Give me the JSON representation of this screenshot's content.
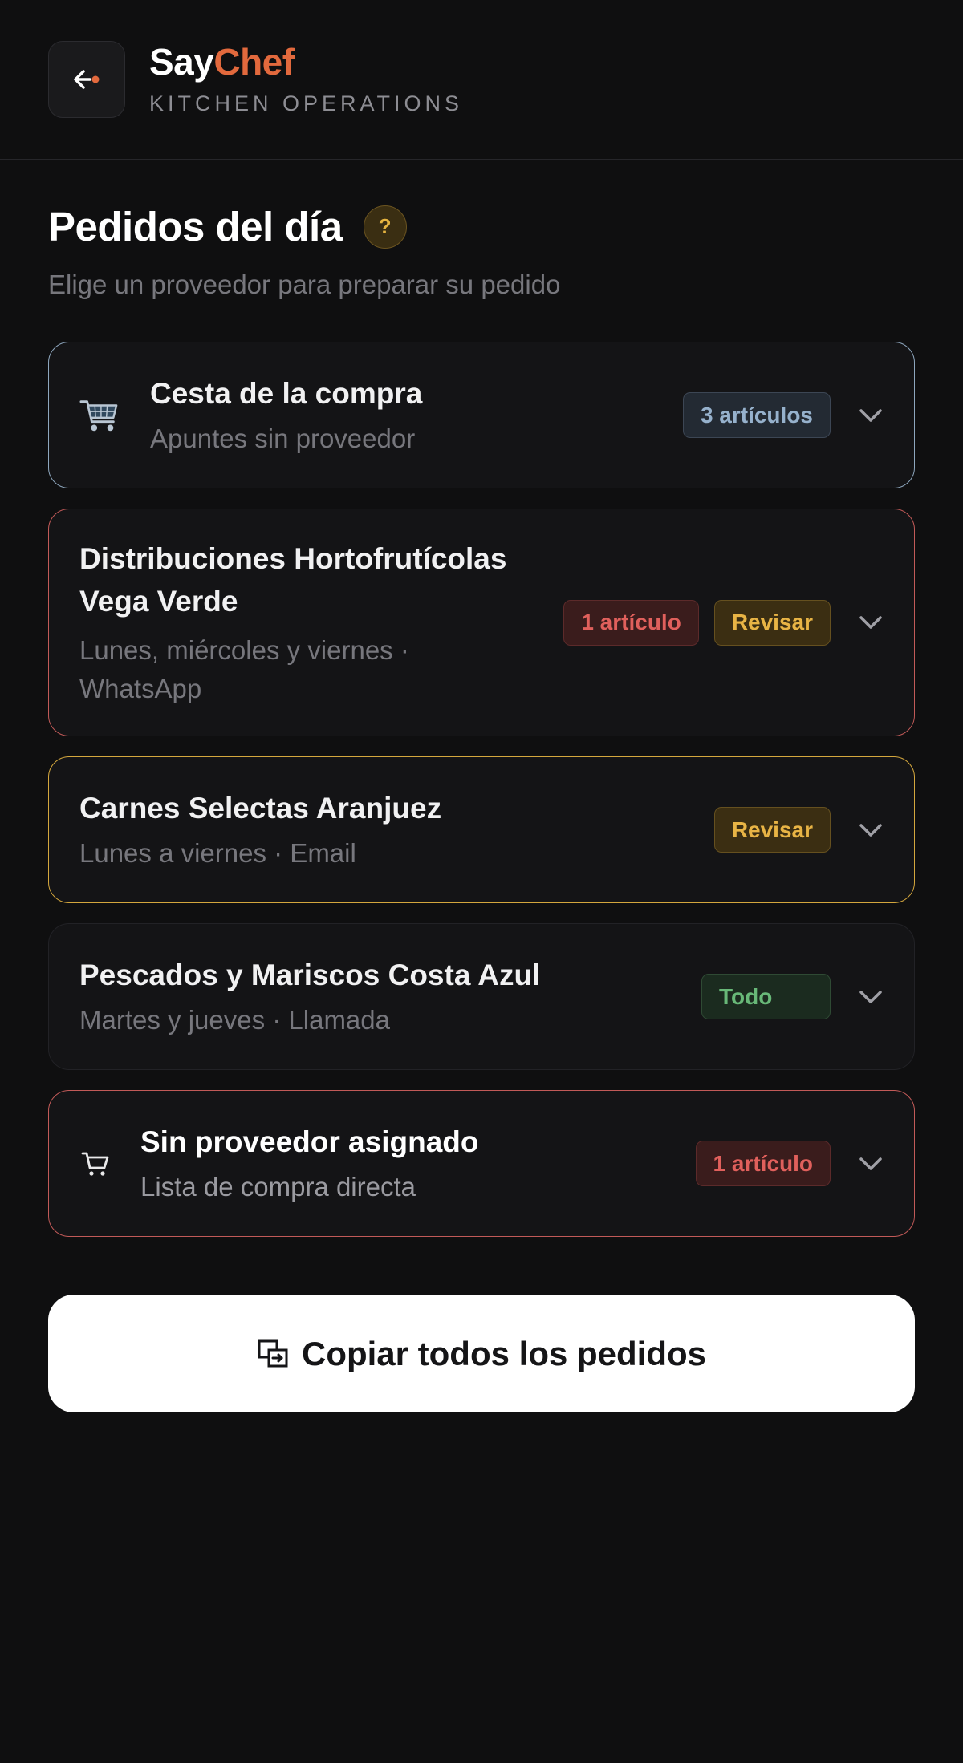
{
  "header": {
    "brand_say": "Say",
    "brand_chef": "Chef",
    "brand_subtitle": "KITCHEN OPERATIONS"
  },
  "page": {
    "title": "Pedidos del día",
    "help_label": "?",
    "subtitle": "Elige un proveedor para preparar su pedido"
  },
  "cards": [
    {
      "title": "Cesta de la compra",
      "subtitle": "Apuntes sin proveedor",
      "badges": [
        "3 artículos"
      ],
      "icon": "shopping-cart-emoji-icon",
      "border_color": "#8ea7be"
    },
    {
      "title": "Distribuciones Hortofrutícolas Vega Verde",
      "subtitle": "Lunes, miércoles y viernes · WhatsApp",
      "badges": [
        "1 artículo",
        "Revisar"
      ],
      "border_color": "#c25a58"
    },
    {
      "title": "Carnes Selectas Aranjuez",
      "subtitle": "Lunes a viernes · Email",
      "badges": [
        "Revisar"
      ],
      "border_color": "#d4a73d"
    },
    {
      "title": "Pescados y Mariscos Costa Azul",
      "subtitle": "Martes y jueves · Llamada",
      "badges": [
        "Todo"
      ],
      "border_color": "#222226"
    },
    {
      "title": "Sin proveedor asignado",
      "subtitle": "Lista de compra directa",
      "badges": [
        "1 artículo"
      ],
      "icon": "cart-outline-icon",
      "border_color": "#c25a58"
    }
  ],
  "actions": {
    "copy_all_label": "Copiar todos los pedidos",
    "copy_icon": "copy-icon"
  },
  "colors": {
    "accent": "#e2693d",
    "background": "#0f0f10",
    "warning": "#e8b445",
    "danger": "#e0605c",
    "success": "#68b878",
    "info": "#96b1cc"
  }
}
